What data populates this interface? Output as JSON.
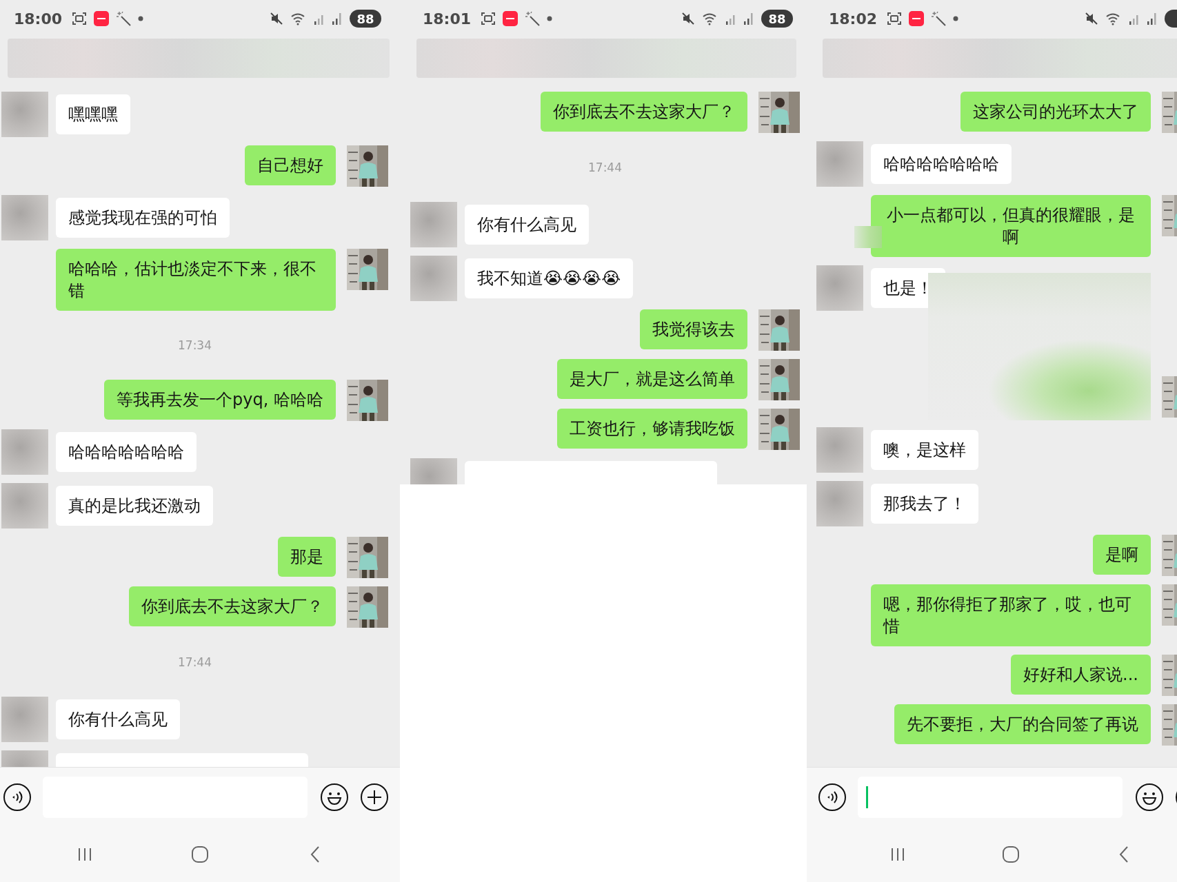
{
  "panels": [
    {
      "status": {
        "time": "18:00",
        "battery": "88"
      },
      "messages": [
        {
          "kind": "incoming",
          "text": "嘿嘿嘿",
          "covered": false
        },
        {
          "kind": "outgoing",
          "text": "自己想好",
          "covered": false
        },
        {
          "kind": "incoming",
          "text": "感觉我现在强的可怕",
          "covered": false
        },
        {
          "kind": "outgoing",
          "text": "哈哈哈，估计也淡定不下来，很不错",
          "covered": false
        },
        {
          "kind": "time",
          "text": "17:34"
        },
        {
          "kind": "outgoing",
          "text": "等我再去发一个pyq, 哈哈哈",
          "covered": false
        },
        {
          "kind": "incoming",
          "text": "哈哈哈哈哈哈哈",
          "covered": false
        },
        {
          "kind": "incoming",
          "text": "真的是比我还激动",
          "covered": false
        },
        {
          "kind": "outgoing",
          "text": "那是",
          "covered": false
        },
        {
          "kind": "outgoing",
          "text": "你到底去不去这家大厂？",
          "covered": false
        },
        {
          "kind": "time",
          "text": "17:44"
        },
        {
          "kind": "incoming",
          "text": "你有什么高见",
          "covered": false
        },
        {
          "kind": "cut"
        }
      ],
      "bottom": {
        "kind": "composer",
        "focused": false
      }
    },
    {
      "status": {
        "time": "18:01",
        "battery": "88"
      },
      "messages": [
        {
          "kind": "outgoing",
          "text": "你到底去不去这家大厂？",
          "covered": false
        },
        {
          "kind": "time",
          "text": "17:44"
        },
        {
          "kind": "incoming",
          "text": "你有什么高见",
          "covered": false
        },
        {
          "kind": "incoming",
          "text": "我不知道😭😭😭😭",
          "covered": false
        },
        {
          "kind": "outgoing",
          "text": "我觉得该去",
          "covered": false
        },
        {
          "kind": "outgoing",
          "text": "是大厂，就是这么简单",
          "covered": false
        },
        {
          "kind": "outgoing",
          "text": "工资也行，够请我吃饭",
          "covered": false
        },
        {
          "kind": "cut"
        }
      ],
      "bottom": {
        "kind": "blank"
      }
    },
    {
      "status": {
        "time": "18:02"
      },
      "messages": [
        {
          "kind": "outgoing",
          "text": "这家公司的光环太大了",
          "covered": false
        },
        {
          "kind": "incoming",
          "text": "哈哈哈哈哈哈哈",
          "covered": false
        },
        {
          "kind": "outgoing",
          "text": "小一点都可以，但真的很耀眼，是啊",
          "covered": true
        },
        {
          "kind": "incoming",
          "text": "也是！",
          "covered": true
        },
        {
          "kind": "incoming",
          "text": "噢，是这样",
          "covered": false
        },
        {
          "kind": "incoming",
          "text": "那我去了！",
          "covered": false
        },
        {
          "kind": "outgoing",
          "text": "是啊",
          "covered": false
        },
        {
          "kind": "outgoing",
          "text": "嗯，那你得拒了那家了，哎，也可惜",
          "covered": false
        },
        {
          "kind": "outgoing",
          "text": "好好和人家说...",
          "covered": false
        },
        {
          "kind": "outgoing",
          "text": "先不要拒，大厂的合同签了再说",
          "covered": false
        }
      ],
      "bottom": {
        "kind": "composer",
        "focused": true
      }
    }
  ]
}
